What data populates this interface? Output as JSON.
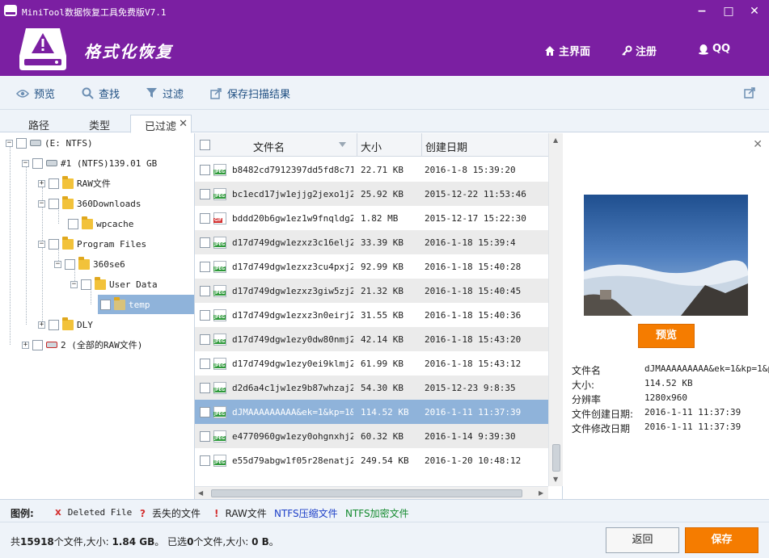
{
  "window": {
    "title": "MiniTool数据恢复工具免费版V7.1",
    "minimize": "−",
    "maximize": "□",
    "close": "✕"
  },
  "header": {
    "section_title": "格式化恢复",
    "nav_home": "主界面",
    "nav_register": "注册",
    "nav_qq": "QQ"
  },
  "toolbar": {
    "preview": "预览",
    "find": "查找",
    "filter": "过滤",
    "save_scan": "保存扫描结果"
  },
  "tabs": [
    {
      "label": "路径"
    },
    {
      "label": "类型"
    },
    {
      "label": "已过滤"
    }
  ],
  "tree": {
    "items": [
      {
        "label": "(E: NTFS)"
      },
      {
        "label": "#1 (NTFS)139.01 GB"
      },
      {
        "label": "RAW文件"
      },
      {
        "label": "360Downloads"
      },
      {
        "label": "wpcache"
      },
      {
        "label": "Program Files"
      },
      {
        "label": "360se6"
      },
      {
        "label": "User Data"
      },
      {
        "label": "temp"
      },
      {
        "label": "DLY"
      },
      {
        "label": "2 (全部的RAW文件)"
      }
    ]
  },
  "list": {
    "columns": {
      "name": "文件名",
      "size": "大小",
      "date": "创建日期"
    },
    "rows": [
      {
        "type": "JPEG",
        "name": "b8482cd7912397dd5fd8c71…",
        "size": "22.71 KB",
        "date": "2016-1-8 15:39:20"
      },
      {
        "type": "JPEG",
        "name": "bc1ecd17jw1ejjg2jexo1j2…",
        "size": "25.92 KB",
        "date": "2015-12-22 11:53:46"
      },
      {
        "type": "GIF",
        "name": "bddd20b6gw1ez1w9fnqldg2…",
        "size": "1.82 MB",
        "date": "2015-12-17 15:22:30"
      },
      {
        "type": "JPEG",
        "name": "d17d749dgw1ezxz3c16elj2…",
        "size": "33.39 KB",
        "date": "2016-1-18 15:39:4"
      },
      {
        "type": "JPEG",
        "name": "d17d749dgw1ezxz3cu4pxj2…",
        "size": "92.99 KB",
        "date": "2016-1-18 15:40:28"
      },
      {
        "type": "JPEG",
        "name": "d17d749dgw1ezxz3giw5zj2…",
        "size": "21.32 KB",
        "date": "2016-1-18 15:40:45"
      },
      {
        "type": "JPEG",
        "name": "d17d749dgw1ezxz3n0eirj2…",
        "size": "31.55 KB",
        "date": "2016-1-18 15:40:36"
      },
      {
        "type": "JPEG",
        "name": "d17d749dgw1ezy0dw80nmj2…",
        "size": "42.14 KB",
        "date": "2016-1-18 15:43:20"
      },
      {
        "type": "JPEG",
        "name": "d17d749dgw1ezy0ei9klmj2…",
        "size": "61.99 KB",
        "date": "2016-1-18 15:43:12"
      },
      {
        "type": "JPEG",
        "name": "d2d6a4c1jw1ez9b87whzaj2…",
        "size": "54.30 KB",
        "date": "2015-12-23 9:8:35"
      },
      {
        "type": "JPEG",
        "name": "dJMAAAAAAAAA&ek=1&kp=1&…",
        "size": "114.52 KB",
        "date": "2016-1-11 11:37:39"
      },
      {
        "type": "JPEG",
        "name": "e4770960gw1ezy0ohgnxhj2…",
        "size": "60.32 KB",
        "date": "2016-1-14 9:39:30"
      },
      {
        "type": "JPEG",
        "name": "e55d79abgw1f05r28enatj2…",
        "size": "249.54 KB",
        "date": "2016-1-20 10:48:12"
      }
    ]
  },
  "preview": {
    "button": "预览",
    "info": [
      {
        "label": "文件名",
        "value": "dJMAAAAAAAAA&ek=1&kp=1&p"
      },
      {
        "label": "大小:",
        "value": "114.52 KB"
      },
      {
        "label": "分辨率",
        "value": "1280x960"
      },
      {
        "label": "文件创建日期:",
        "value": "2016-1-11 11:37:39"
      },
      {
        "label": "文件修改日期",
        "value": "2016-1-11 11:37:39"
      }
    ]
  },
  "legend": {
    "title": "图例:",
    "deleted": {
      "mark": "x",
      "label": "Deleted File"
    },
    "lost": {
      "mark": "?",
      "label": "丢失的文件"
    },
    "raw": {
      "mark": "!",
      "label": "RAW文件"
    },
    "compressed": "NTFS压缩文件",
    "encrypted": "NTFS加密文件"
  },
  "status": {
    "p1": "共",
    "count": "15918",
    "p2": "个文件,大小:",
    "size": "1.84 GB",
    "p3": "。 已选",
    "sel_count": "0",
    "p4": "个文件,大小:",
    "sel_size": "0 B",
    "p5": "。"
  },
  "buttons": {
    "back": "返回",
    "save": "保存"
  },
  "colors": {
    "header": "#7b1fa2",
    "accent": "#f57c00",
    "selection": "#8fb3da"
  }
}
